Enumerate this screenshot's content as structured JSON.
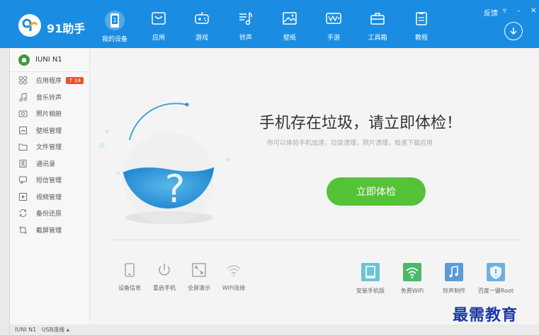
{
  "app": {
    "name": "91助手"
  },
  "window": {
    "feedback": "反馈",
    "menu": "▿",
    "minimize": "–",
    "close": "✕"
  },
  "nav": [
    {
      "label": "我的设备",
      "icon": "device-icon"
    },
    {
      "label": "应用",
      "icon": "app-icon"
    },
    {
      "label": "游戏",
      "icon": "gamepad-icon"
    },
    {
      "label": "铃声",
      "icon": "music-icon"
    },
    {
      "label": "壁纸",
      "icon": "wallpaper-icon"
    },
    {
      "label": "手游",
      "icon": "mobile-game-icon"
    },
    {
      "label": "工具箱",
      "icon": "toolbox-icon"
    },
    {
      "label": "教程",
      "icon": "tutorial-icon"
    }
  ],
  "device": {
    "name": "IUNI N1"
  },
  "sidebar": {
    "items": [
      {
        "label": "应用程序",
        "icon": "apps-grid-icon",
        "badge": "14"
      },
      {
        "label": "音乐铃声",
        "icon": "music-note-icon"
      },
      {
        "label": "照片相册",
        "icon": "camera-icon"
      },
      {
        "label": "壁纸管理",
        "icon": "wallpaper-icon"
      },
      {
        "label": "文件管理",
        "icon": "folder-icon"
      },
      {
        "label": "通讯录",
        "icon": "contacts-icon"
      },
      {
        "label": "短信管理",
        "icon": "sms-icon"
      },
      {
        "label": "视频管理",
        "icon": "video-icon"
      },
      {
        "label": "备份还原",
        "icon": "backup-icon"
      },
      {
        "label": "截屏管理",
        "icon": "screenshot-icon"
      }
    ]
  },
  "main": {
    "headline": "手机存在垃圾，请立即体检！",
    "subtext": "你可以体验手机加速，垃圾清理，照片清理，极速下载应用",
    "check_button": "立即体检",
    "gauge_symbol": "?"
  },
  "tools_left": [
    {
      "label": "设备信息",
      "icon": "device-info-icon"
    },
    {
      "label": "重启手机",
      "icon": "power-icon"
    },
    {
      "label": "全屏演示",
      "icon": "fullscreen-icon"
    },
    {
      "label": "WiFi连接",
      "icon": "wifi-icon"
    }
  ],
  "tools_right": [
    {
      "label": "安装手机版",
      "icon": "install-phone-icon"
    },
    {
      "label": "免费WiFi",
      "icon": "free-wifi-icon"
    },
    {
      "label": "铃声制作",
      "icon": "ringtone-maker-icon"
    },
    {
      "label": "百度一键Root",
      "icon": "root-shield-icon"
    }
  ],
  "status": {
    "device": "IUNI N1",
    "connection": "USB连接",
    "caret": "▴"
  },
  "watermark": "最需教育",
  "colors": {
    "header": "#1a8de3",
    "accent_green": "#55c237",
    "badge": "#e8552c",
    "gauge_blue": "#2996d8",
    "watermark": "#1a37a8"
  }
}
